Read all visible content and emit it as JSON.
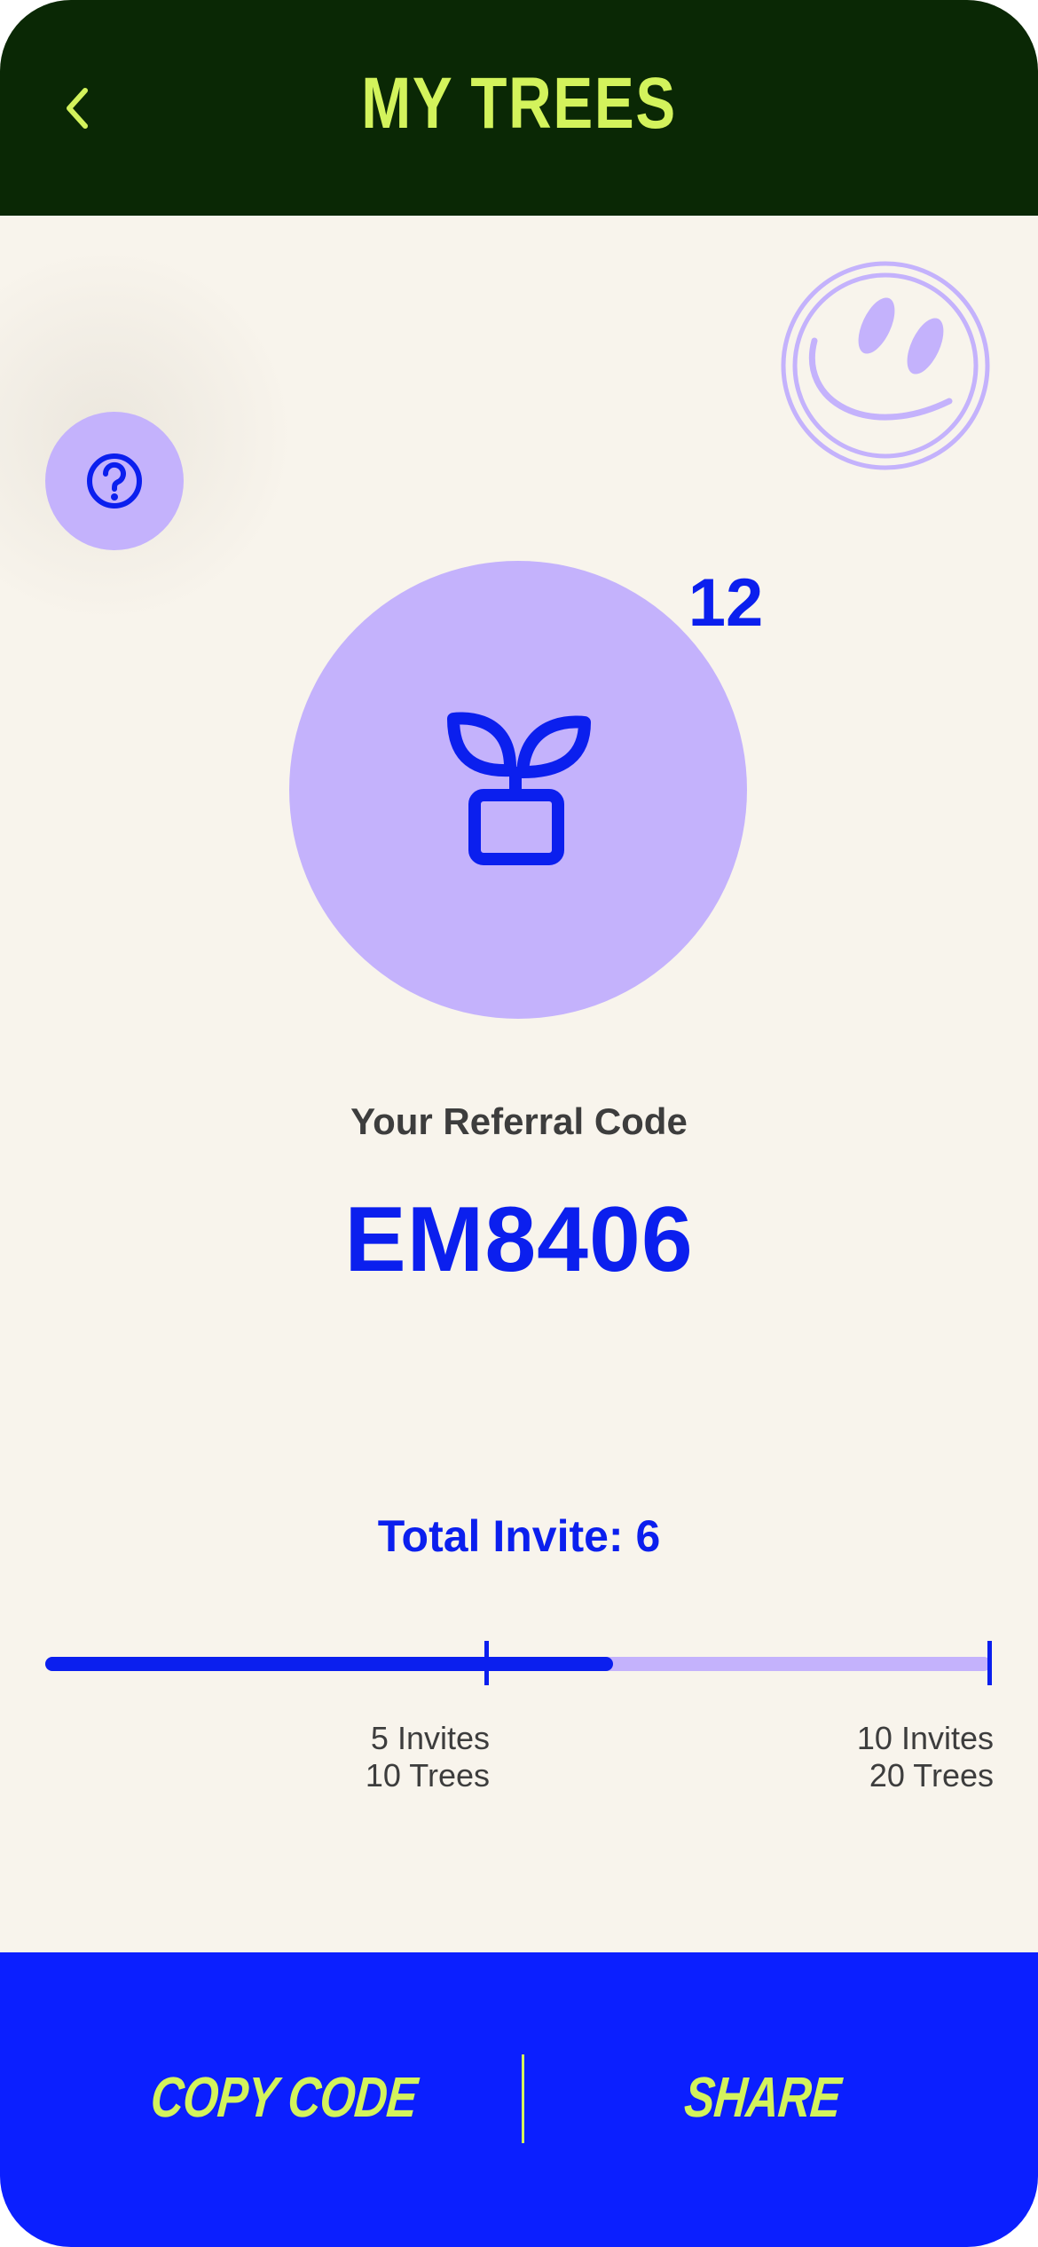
{
  "header": {
    "title": "MY TREES"
  },
  "tree": {
    "count": "12"
  },
  "referral": {
    "label": "Your Referral Code",
    "code": "EM8406"
  },
  "invites": {
    "total_text": "Total Invite: 6",
    "progress_fraction": 0.6,
    "milestones": [
      {
        "invites": "5 Invites",
        "trees": "10 Trees"
      },
      {
        "invites": "10 Invites",
        "trees": "20 Trees"
      }
    ]
  },
  "actions": {
    "copy_label": "COPY CODE",
    "share_label": "SHARE"
  },
  "icons": {
    "back": "chevron-left-icon",
    "help": "question-circle-icon",
    "decoration": "smiley-icon",
    "plant": "plant-pot-icon"
  },
  "colors": {
    "header_bg": "#0a2805",
    "accent_lime": "#d3f35c",
    "accent_blue": "#0b1fee",
    "lavender": "#c4b2fc",
    "page_bg": "#f8f4ec",
    "bottom_bar": "#0b1fff"
  }
}
